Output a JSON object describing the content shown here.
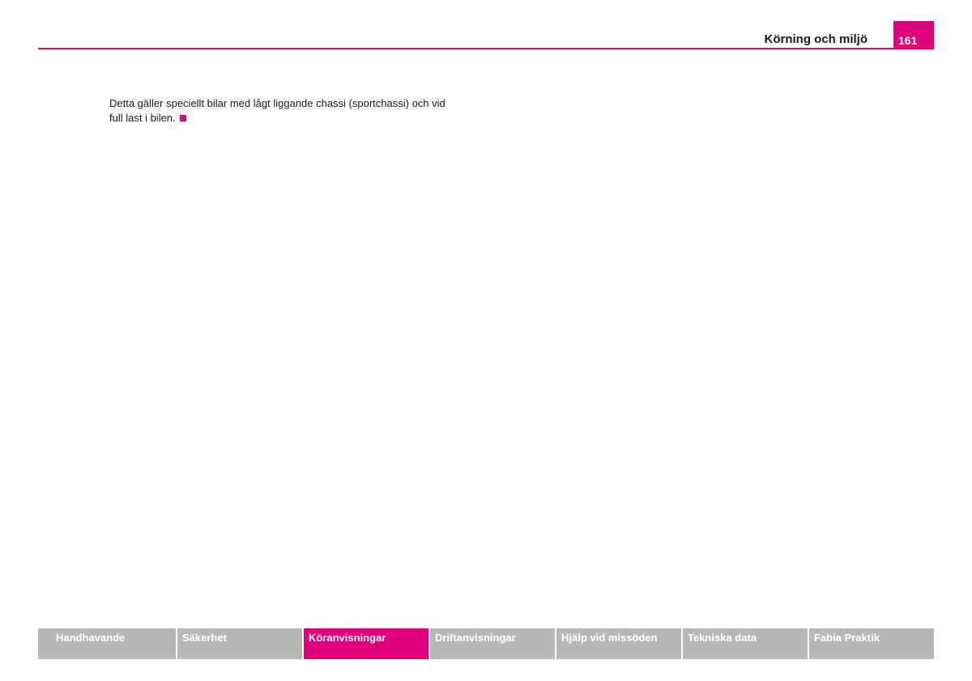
{
  "header": {
    "section_title": "Körning och miljö",
    "page_number": "161",
    "accent_color": "#e0007a"
  },
  "body": {
    "line1": "Detta gäller speciellt bilar med lågt liggande chassi (sportchassi) och vid",
    "line2": "full last i bilen."
  },
  "footer_nav": {
    "active_index": 2,
    "tabs": [
      {
        "label": "Handhavande"
      },
      {
        "label": "Säkerhet"
      },
      {
        "label": "Köranvisningar"
      },
      {
        "label": "Driftanvisningar"
      },
      {
        "label": "Hjälp vid missöden"
      },
      {
        "label": "Tekniska data"
      },
      {
        "label": "Fabia Praktik"
      }
    ]
  }
}
